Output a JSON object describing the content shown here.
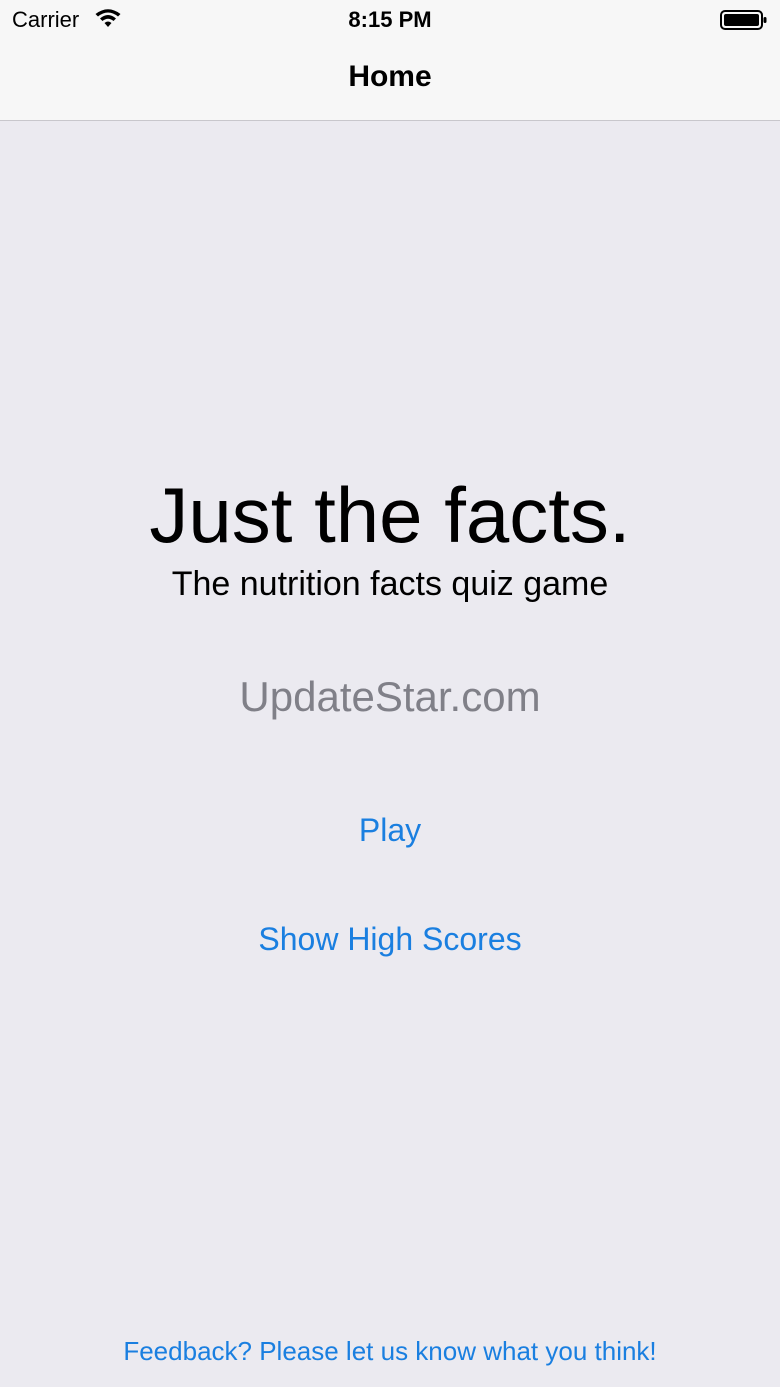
{
  "status_bar": {
    "carrier": "Carrier",
    "time": "8:15 PM",
    "icons": [
      "wifi-icon",
      "battery-icon"
    ]
  },
  "nav": {
    "title": "Home"
  },
  "main": {
    "headline": "Just the facts.",
    "subheadline": "The nutrition facts quiz game",
    "watermark": "UpdateStar.com",
    "play_label": "Play",
    "high_scores_label": "Show High Scores"
  },
  "footer": {
    "feedback_label": "Feedback? Please let us know what you think!"
  },
  "colors": {
    "background": "#ebeaf0",
    "bar": "#f7f7f7",
    "accent": "#1a7fe0",
    "watermark": "#808088"
  }
}
